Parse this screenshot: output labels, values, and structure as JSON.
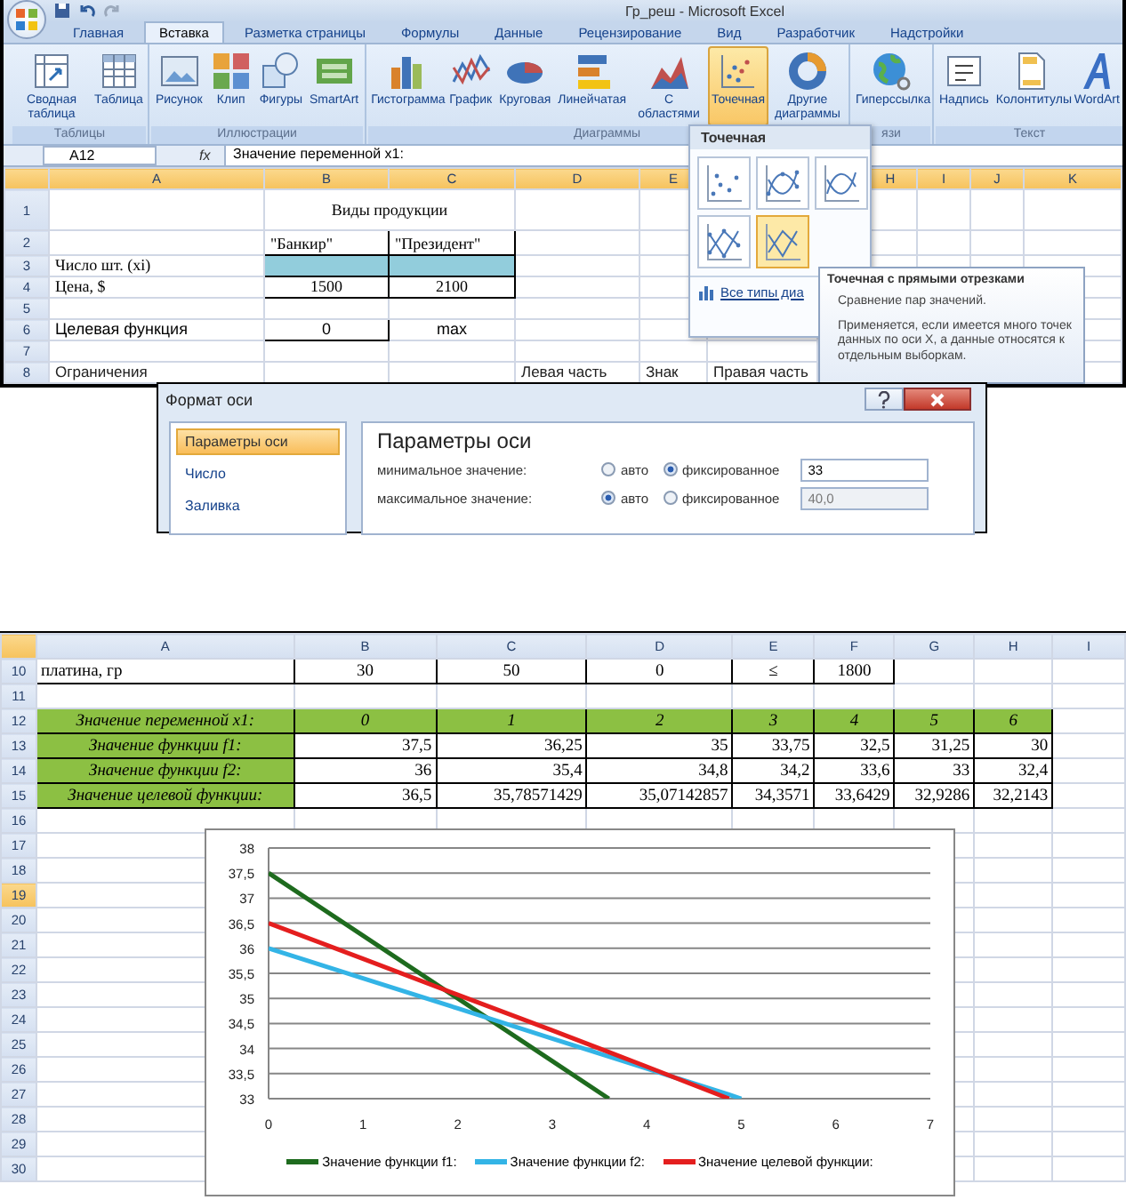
{
  "window": {
    "title": "Гр_реш - Microsoft Excel"
  },
  "ribbon": {
    "tabs": [
      {
        "label": "Главная",
        "selected": false
      },
      {
        "label": "Вставка",
        "selected": true
      },
      {
        "label": "Разметка страницы",
        "selected": false
      },
      {
        "label": "Формулы",
        "selected": false
      },
      {
        "label": "Данные",
        "selected": false
      },
      {
        "label": "Рецензирование",
        "selected": false
      },
      {
        "label": "Вид",
        "selected": false
      },
      {
        "label": "Разработчик",
        "selected": false
      },
      {
        "label": "Надстройки",
        "selected": false
      }
    ],
    "groups": [
      {
        "label": "Таблицы",
        "buttons": [
          {
            "label": "Сводная таблица",
            "kind": "pivot",
            "selected": false
          },
          {
            "label": "Таблица",
            "kind": "table",
            "selected": false
          }
        ]
      },
      {
        "label": "Иллюстрации",
        "buttons": [
          {
            "label": "Рисунок",
            "kind": "picture",
            "selected": false
          },
          {
            "label": "Клип",
            "kind": "clip",
            "selected": false
          },
          {
            "label": "Фигуры",
            "kind": "shapes",
            "selected": false
          },
          {
            "label": "SmartArt",
            "kind": "smartart",
            "selected": false
          }
        ]
      },
      {
        "label": "Диаграммы",
        "buttons": [
          {
            "label": "Гистограмма",
            "kind": "column",
            "selected": false
          },
          {
            "label": "График",
            "kind": "line",
            "selected": false
          },
          {
            "label": "Круговая",
            "kind": "pie",
            "selected": false
          },
          {
            "label": "Линейчатая",
            "kind": "bar",
            "selected": false
          },
          {
            "label": "С областями",
            "kind": "area",
            "selected": false
          },
          {
            "label": "Точечная",
            "kind": "scatter",
            "selected": true
          },
          {
            "label": "Другие диаграммы",
            "kind": "donut",
            "selected": false
          }
        ]
      },
      {
        "label": "язи",
        "buttons": [
          {
            "label": "Гиперссылка",
            "kind": "globe",
            "selected": false
          }
        ]
      },
      {
        "label": "Текст",
        "buttons": [
          {
            "label": "Надпись",
            "kind": "textbox",
            "selected": false
          },
          {
            "label": "Колонтитулы",
            "kind": "page",
            "selected": false
          },
          {
            "label": "WordArt",
            "kind": "wordart",
            "selected": false
          }
        ]
      }
    ]
  },
  "formula_bar": {
    "name_box": "A12",
    "fx": "fx",
    "value": "Значение переменной x1:"
  },
  "gallery": {
    "title": "Точечная",
    "items": [
      {
        "kind": "markers",
        "selected": false
      },
      {
        "kind": "smooth-markers",
        "selected": false
      },
      {
        "kind": "smooth",
        "selected": false
      },
      {
        "kind": "straight-markers",
        "selected": false
      },
      {
        "kind": "straight",
        "selected": true
      }
    ],
    "footer": "Все типы диа"
  },
  "tooltip": {
    "title": "Точечная с прямыми отрезками",
    "lines": [
      "Сравнение пар значений.",
      "Применяется, если имеется много точек данных по оси X, а данные относятся к отдельным выборкам."
    ]
  },
  "sheet_top": {
    "columns": [
      "A",
      "B",
      "C",
      "D",
      "E",
      null,
      null,
      "H",
      "I",
      "J",
      "K"
    ],
    "rows": [
      {
        "header": "1",
        "cells": [
          null,
          {
            "text": "Виды продукции",
            "kind": "title",
            "colspan": 2
          }
        ]
      },
      {
        "header": "2",
        "cells": [
          null,
          {
            "text": "\"Банкир\"",
            "kind": "box-top"
          },
          {
            "text": "\"Президент\"",
            "kind": "box-top"
          }
        ]
      },
      {
        "header": "3",
        "cells": [
          {
            "text": "Число шт. (xi)",
            "kind": "serif-left"
          },
          {
            "kind": "fill"
          },
          {
            "kind": "fill"
          }
        ]
      },
      {
        "header": "4",
        "cells": [
          {
            "text": "Цена, $",
            "kind": "serif-left"
          },
          {
            "text": "1500",
            "kind": "box-c"
          },
          {
            "text": "2100",
            "kind": "box-c"
          }
        ]
      },
      {
        "header": "5",
        "cells": []
      },
      {
        "header": "6",
        "cells": [
          {
            "text": "Целевая функция",
            "kind": "italic-sans"
          },
          {
            "text": "0",
            "kind": "box-sans"
          },
          {
            "text": "max",
            "kind": "sans-c"
          }
        ]
      },
      {
        "header": "7",
        "cells": []
      },
      {
        "header": "8",
        "cells": [
          {
            "text": "Ограничения",
            "kind": "sans-left"
          },
          null,
          null,
          {
            "text": "Левая часть",
            "kind": "sans-left"
          },
          {
            "text": "Знак",
            "kind": "sans-left"
          },
          {
            "text": "Правая часть",
            "kind": "sans-left"
          }
        ]
      }
    ]
  },
  "dialog": {
    "title": "Формат оси",
    "nav": [
      {
        "label": "Параметры оси",
        "selected": true
      },
      {
        "label": "Число",
        "selected": false
      },
      {
        "label": "Заливка",
        "selected": false
      }
    ],
    "heading": "Параметры оси",
    "fields": [
      {
        "label": "минимальное значение:",
        "options": [
          {
            "label": "авто",
            "selected": false
          },
          {
            "label": "фиксированное",
            "selected": true
          }
        ],
        "value": "33",
        "disabled": false
      },
      {
        "label": "максимальное значение:",
        "options": [
          {
            "label": "авто",
            "selected": true
          },
          {
            "label": "фиксированное",
            "selected": false
          }
        ],
        "value": "40,0",
        "disabled": true
      }
    ]
  },
  "sheet_bottom": {
    "columns": [
      "A",
      "B",
      "C",
      "D",
      "E",
      "F",
      "G",
      "H",
      "I"
    ],
    "rows": [
      {
        "header": "10",
        "selected": false,
        "cells": [
          {
            "text": "платина, гр",
            "kind": "box-l"
          },
          {
            "text": "30",
            "kind": "box-c"
          },
          {
            "text": "50",
            "kind": "box-c"
          },
          {
            "text": "0",
            "kind": "box-c"
          },
          {
            "text": "≤",
            "kind": "box-c"
          },
          {
            "text": "1800",
            "kind": "box-c"
          }
        ]
      },
      {
        "header": "11",
        "selected": false,
        "cells": []
      },
      {
        "header": "12",
        "selected": false,
        "cells": [
          {
            "text": "Значение переменной x1:",
            "kind": "green"
          },
          {
            "text": "0",
            "kind": "green"
          },
          {
            "text": "1",
            "kind": "green"
          },
          {
            "text": "2",
            "kind": "green"
          },
          {
            "text": "3",
            "kind": "green"
          },
          {
            "text": "4",
            "kind": "green"
          },
          {
            "text": "5",
            "kind": "green"
          },
          {
            "text": "6",
            "kind": "green"
          }
        ]
      },
      {
        "header": "13",
        "selected": false,
        "cells": [
          {
            "text": "Значение функции f1:",
            "kind": "green"
          },
          {
            "text": "37,5",
            "kind": "box-r"
          },
          {
            "text": "36,25",
            "kind": "box-r"
          },
          {
            "text": "35",
            "kind": "box-r"
          },
          {
            "text": "33,75",
            "kind": "box-r"
          },
          {
            "text": "32,5",
            "kind": "box-r"
          },
          {
            "text": "31,25",
            "kind": "box-r"
          },
          {
            "text": "30",
            "kind": "box-r"
          }
        ]
      },
      {
        "header": "14",
        "selected": false,
        "cells": [
          {
            "text": "Значение функции f2:",
            "kind": "green"
          },
          {
            "text": "36",
            "kind": "box-r"
          },
          {
            "text": "35,4",
            "kind": "box-r"
          },
          {
            "text": "34,8",
            "kind": "box-r"
          },
          {
            "text": "34,2",
            "kind": "box-r"
          },
          {
            "text": "33,6",
            "kind": "box-r"
          },
          {
            "text": "33",
            "kind": "box-r"
          },
          {
            "text": "32,4",
            "kind": "box-r"
          }
        ]
      },
      {
        "header": "15",
        "selected": false,
        "cells": [
          {
            "text": "Значение целевой функции:",
            "kind": "green"
          },
          {
            "text": "36,5",
            "kind": "box-r"
          },
          {
            "text": "35,78571429",
            "kind": "box-r"
          },
          {
            "text": "35,07142857",
            "kind": "box-r"
          },
          {
            "text": "34,3571",
            "kind": "box-r"
          },
          {
            "text": "33,6429",
            "kind": "box-r"
          },
          {
            "text": "32,9286",
            "kind": "box-r"
          },
          {
            "text": "32,2143",
            "kind": "box-r"
          }
        ]
      },
      {
        "header": "16",
        "selected": false,
        "cells": []
      },
      {
        "header": "17",
        "selected": false,
        "cells": []
      },
      {
        "header": "18",
        "selected": false,
        "cells": []
      },
      {
        "header": "19",
        "selected": true,
        "cells": []
      },
      {
        "header": "20",
        "selected": false,
        "cells": []
      },
      {
        "header": "21",
        "selected": false,
        "cells": []
      },
      {
        "header": "22",
        "selected": false,
        "cells": []
      },
      {
        "header": "23",
        "selected": false,
        "cells": []
      },
      {
        "header": "24",
        "selected": false,
        "cells": []
      },
      {
        "header": "25",
        "selected": false,
        "cells": []
      },
      {
        "header": "26",
        "selected": false,
        "cells": []
      },
      {
        "header": "27",
        "selected": false,
        "cells": []
      },
      {
        "header": "28",
        "selected": false,
        "cells": []
      },
      {
        "header": "29",
        "selected": false,
        "cells": []
      },
      {
        "header": "30",
        "selected": false,
        "cells": []
      }
    ],
    "chart_data": {
      "type": "line",
      "grid": true,
      "legend": "bottom",
      "x": [
        0,
        1,
        2,
        3,
        3.6,
        4,
        4.87,
        5
      ],
      "xlim": [
        0,
        7
      ],
      "ylim": [
        33,
        38
      ],
      "xticks": [
        0,
        1,
        2,
        3,
        4,
        5,
        6,
        7
      ],
      "yticks": [
        33,
        {
          "value": 33.5,
          "label": "33,5"
        },
        34,
        {
          "value": 34.5,
          "label": "34,5"
        },
        35,
        {
          "value": 35.5,
          "label": "35,5"
        },
        36,
        {
          "value": 36.5,
          "label": "36,5"
        },
        37,
        {
          "value": 37.5,
          "label": "37,5"
        },
        38
      ],
      "series": [
        {
          "name": "Значение функции f1:",
          "color": "#1e6b1e",
          "values": [
            37.5,
            36.25,
            35,
            33.75,
            33,
            null,
            null,
            null
          ]
        },
        {
          "name": "Значение функции f2:",
          "color": "#33b4e6",
          "values": [
            36,
            35.4,
            34.8,
            34.2,
            33.84,
            33.6,
            33.08,
            33
          ]
        },
        {
          "name": "Значение целевой функции:",
          "color": "#e41e1e",
          "values": [
            36.5,
            35.79,
            35.07,
            34.36,
            33.93,
            33.64,
            33,
            null
          ]
        }
      ]
    }
  }
}
